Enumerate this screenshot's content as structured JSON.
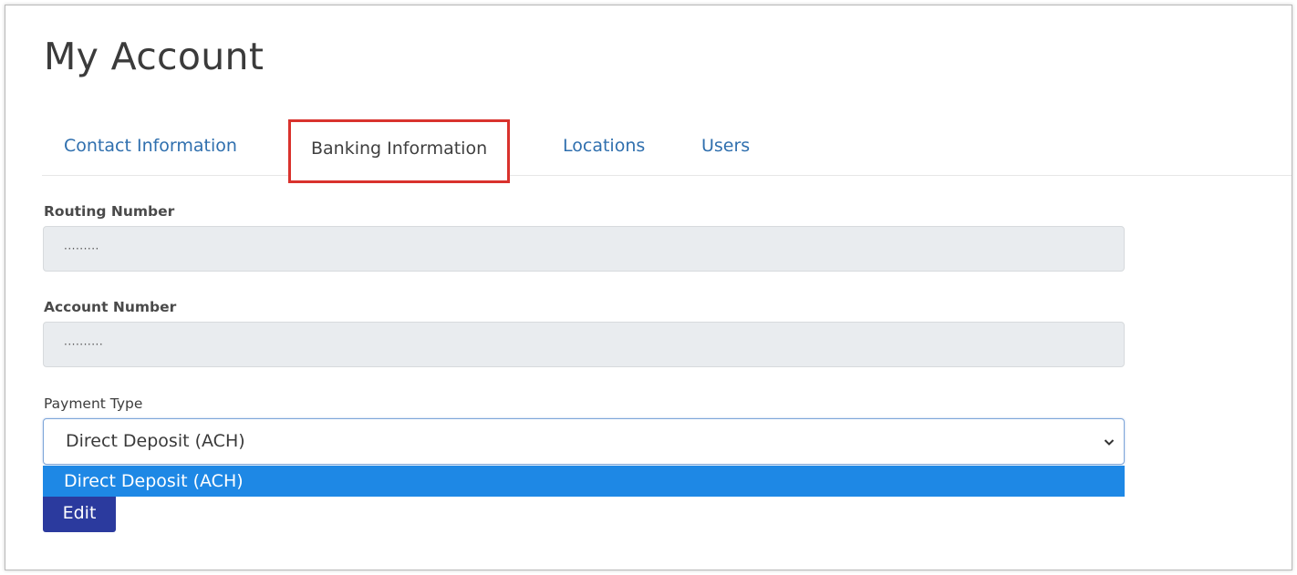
{
  "page": {
    "title": "My Account"
  },
  "tabs": [
    {
      "label": "Contact Information",
      "active": false
    },
    {
      "label": "Banking Information",
      "active": true
    },
    {
      "label": "Locations",
      "active": false
    },
    {
      "label": "Users",
      "active": false
    }
  ],
  "form": {
    "routing_label": "Routing Number",
    "routing_value": "·········",
    "account_label": "Account Number",
    "account_value": "··········",
    "payment_label": "Payment Type",
    "payment_selected": "Direct Deposit (ACH)",
    "payment_options": [
      "Direct Deposit (ACH)"
    ],
    "edit_label": "Edit"
  },
  "colors": {
    "link": "#2f6fae",
    "highlight_border": "#d9322d",
    "dropdown_highlight": "#1e88e5",
    "button": "#2b3a9e"
  },
  "icons": {
    "select_chevron": "chevron-down-icon"
  }
}
